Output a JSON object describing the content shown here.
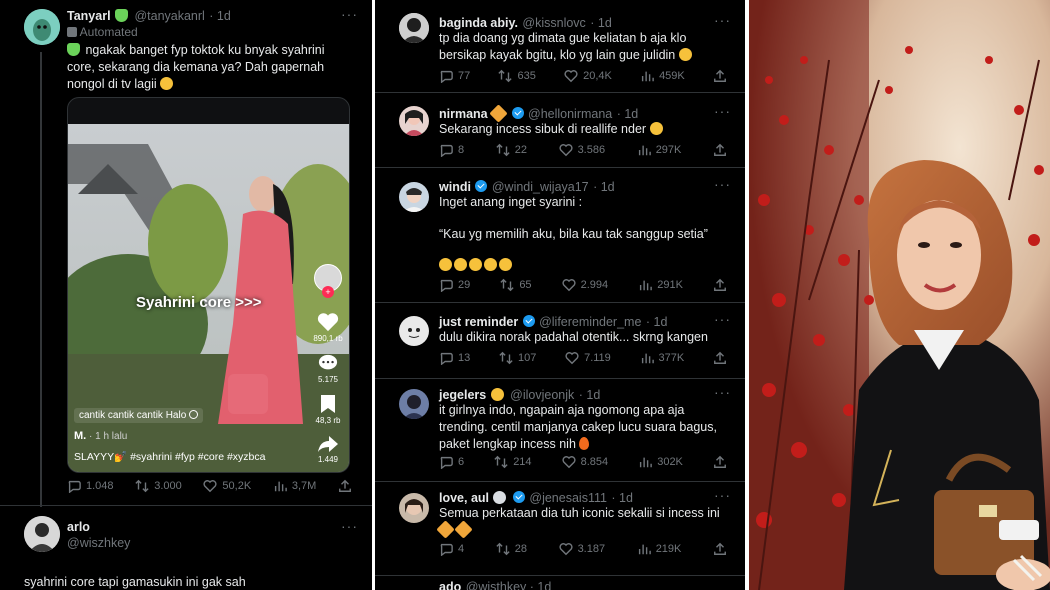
{
  "panel1": {
    "tweet": {
      "name": "Tanyarl",
      "handle": "@tanyakanrl",
      "time": "· 1d",
      "automated": "Automated",
      "text_lines": [
        "ngakak banget fyp toktok ku bnyak syahrini",
        "core, sekarang dia kemana ya? Dah gapernah",
        "nongol di tv lagii"
      ],
      "video": {
        "overlay_text": "Syahrini core >>>",
        "likes": "890,1 rb",
        "comments": "5.175",
        "saves": "48,3 rb",
        "shares": "1.449",
        "sound": "cantik cantik cantik Halo",
        "author": "M.",
        "author_time": "· 1 h lalu",
        "caption": "SLAYYY💅 #syahrini #fyp #core #xyzbca"
      },
      "stats": {
        "replies": "1.048",
        "retweets": "3.000",
        "likes": "50,2K",
        "views": "3,7M"
      }
    },
    "reply": {
      "name": "arlo",
      "handle": "@wiszhkey",
      "text": "syahrini core tapi gamasukin ini gak sah"
    }
  },
  "panel2": {
    "replies": [
      {
        "name": "baginda abiy.",
        "handle": "@kissnlovc",
        "time": "· 1d",
        "verified": false,
        "lines": [
          "tp dia doang yg dimata gue keliatan b aja klo",
          "bersikap kayak bgitu, klo yg lain gue julidin"
        ],
        "stats": {
          "replies": "77",
          "retweets": "635",
          "likes": "20,4K",
          "views": "459K"
        }
      },
      {
        "name": "nirmana",
        "handle": "@hellonirmana",
        "time": "· 1d",
        "verified": true,
        "lines": [
          "Sekarang incess sibuk di reallife nder"
        ],
        "stats": {
          "replies": "8",
          "retweets": "22",
          "likes": "3.586",
          "views": "297K"
        }
      },
      {
        "name": "windi",
        "handle": "@windi_wijaya17",
        "time": "· 1d",
        "verified": true,
        "lines": [
          "Inget anang inget syarini :",
          "",
          "“Kau yg memilih aku, bila kau tak sanggup setia”",
          ""
        ],
        "stats": {
          "replies": "29",
          "retweets": "65",
          "likes": "2.994",
          "views": "291K"
        }
      },
      {
        "name": "just reminder",
        "handle": "@lifereminder_me",
        "time": "· 1d",
        "verified": true,
        "lines": [
          "dulu dikira norak padahal otentik... skrng kangen"
        ],
        "stats": {
          "replies": "13",
          "retweets": "107",
          "likes": "7.119",
          "views": "377K"
        }
      },
      {
        "name": "jegelers",
        "handle": "@ilovjeonjk",
        "time": "· 1d",
        "verified": false,
        "lines": [
          "it girlnya indo, ngapain aja ngomong apa aja",
          "trending. centil manjanya cakep lucu suara bagus,",
          "paket lengkap incess nih"
        ],
        "stats": {
          "replies": "6",
          "retweets": "214",
          "likes": "8.854",
          "views": "302K"
        }
      },
      {
        "name": "love, aul",
        "handle": "@jenesais111",
        "time": "· 1d",
        "verified": true,
        "lines": [
          "Semua perkataan dia tuh iconic sekalii si incess ini",
          ""
        ],
        "stats": {
          "replies": "4",
          "retweets": "28",
          "likes": "3.187",
          "views": "219K"
        }
      }
    ],
    "partial": {
      "name": "ado",
      "handle": "@wisthkey · 1d"
    }
  },
  "colors": {
    "accent": "#1d9bf0",
    "bg": "#000000",
    "muted": "#71767b",
    "text": "#e7e9ea"
  }
}
